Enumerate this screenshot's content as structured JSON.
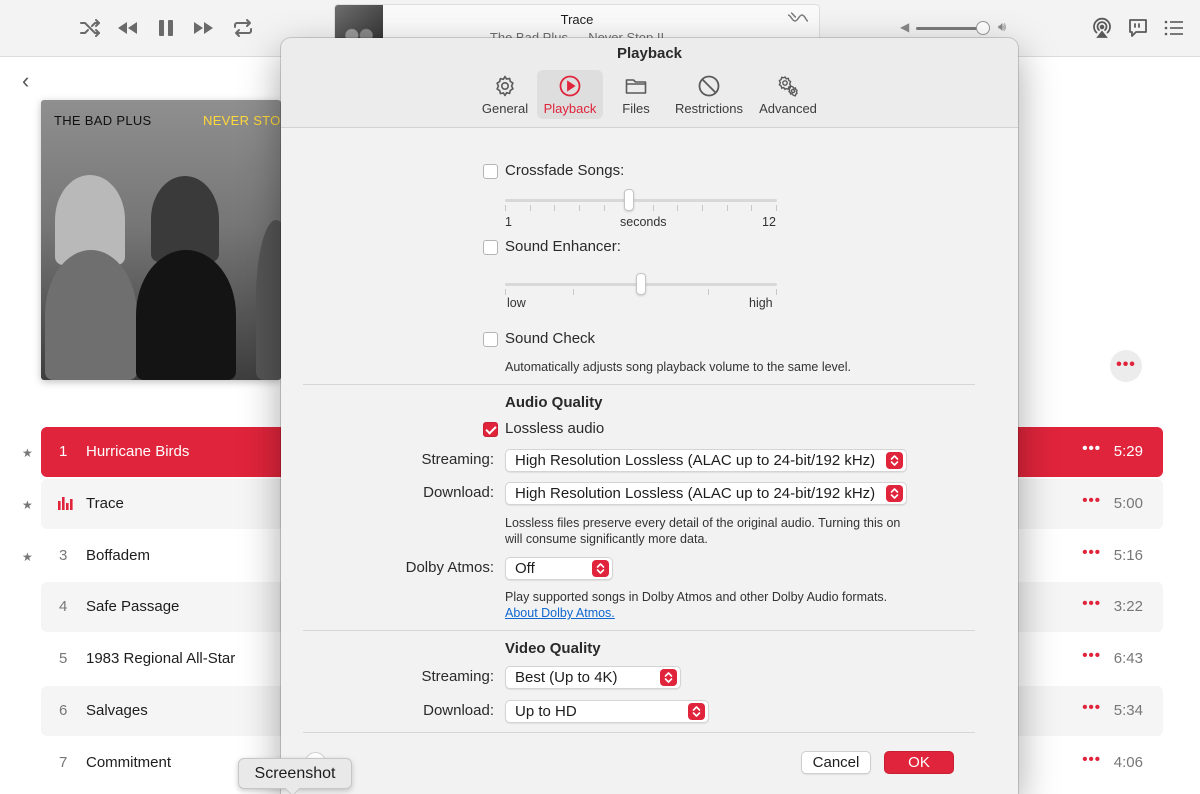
{
  "colors": {
    "accent": "#e0243b",
    "link": "#1068d0"
  },
  "player": {
    "now_playing_title": "Trace",
    "now_playing_subtitle": "The Bad Plus — Never Stop II",
    "volume": 0.85
  },
  "album": {
    "art_band": "THE BAD PLUS",
    "art_title": "NEVER STOP"
  },
  "tracks": [
    {
      "num": "1",
      "name": "Hurricane Birds",
      "duration": "5:29",
      "starred": true,
      "state": "selected"
    },
    {
      "num": "",
      "name": "Trace",
      "duration": "5:00",
      "starred": true,
      "state": "playing"
    },
    {
      "num": "3",
      "name": "Boffadem",
      "duration": "5:16",
      "starred": true,
      "state": ""
    },
    {
      "num": "4",
      "name": "Safe Passage",
      "duration": "3:22",
      "starred": false,
      "state": ""
    },
    {
      "num": "5",
      "name": "1983 Regional All-Star",
      "duration": "6:43",
      "starred": false,
      "state": ""
    },
    {
      "num": "6",
      "name": "Salvages",
      "duration": "5:34",
      "starred": false,
      "state": ""
    },
    {
      "num": "7",
      "name": "Commitment",
      "duration": "4:06",
      "starred": false,
      "state": ""
    }
  ],
  "dialog": {
    "title": "Playback",
    "tabs": [
      "General",
      "Playback",
      "Files",
      "Restrictions",
      "Advanced"
    ],
    "selected_tab": "Playback",
    "crossfade": {
      "label": "Crossfade Songs:",
      "checked": false,
      "min": "1",
      "unit": "seconds",
      "max": "12",
      "value": 6
    },
    "sound_enhancer": {
      "label": "Sound Enhancer:",
      "checked": false,
      "low": "low",
      "high": "high",
      "level": 0.5
    },
    "sound_check": {
      "label": "Sound Check",
      "checked": false,
      "description": "Automatically adjusts song playback volume to the same level."
    },
    "audio_quality": {
      "header": "Audio Quality",
      "lossless_label": "Lossless audio",
      "lossless_checked": true,
      "streaming_label": "Streaming:",
      "streaming_value": "High Resolution Lossless (ALAC up to 24-bit/192 kHz)",
      "download_label": "Download:",
      "download_value": "High Resolution Lossless (ALAC up to 24-bit/192 kHz)",
      "note_line1": "Lossless files preserve every detail of the original audio. Turning this on",
      "note_line2": "will consume significantly more data.",
      "dolby_label": "Dolby Atmos:",
      "dolby_value": "Off",
      "dolby_note": "Play supported songs in Dolby Atmos and other Dolby Audio formats.",
      "dolby_link": "About Dolby Atmos."
    },
    "video_quality": {
      "header": "Video Quality",
      "streaming_label": "Streaming:",
      "streaming_value": "Best (Up to 4K)",
      "download_label": "Download:",
      "download_value": "Up to HD"
    },
    "help_label": "?",
    "cancel_label": "Cancel",
    "ok_label": "OK"
  },
  "tooltip": "Screenshot"
}
